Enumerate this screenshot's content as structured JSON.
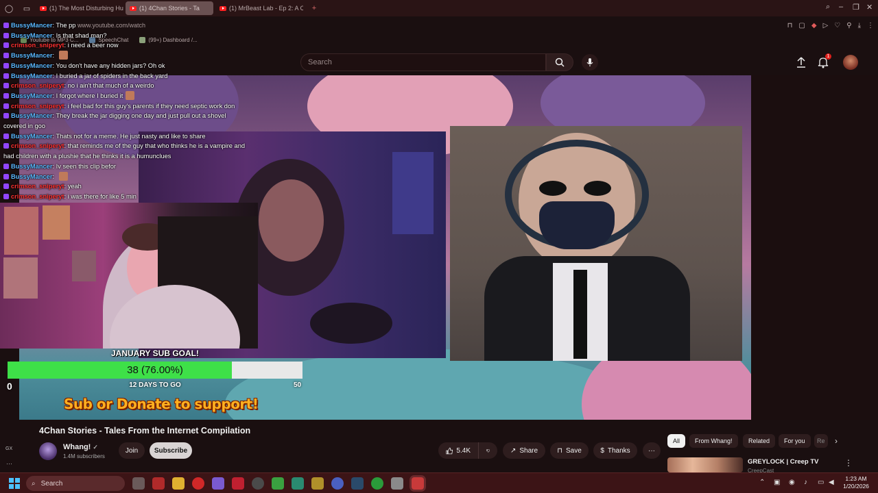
{
  "browser": {
    "tabs": [
      {
        "label": "(1) The Most Disturbing Hu",
        "active": false
      },
      {
        "label": "(1) 4Chan Stories - Ta",
        "active": true
      },
      {
        "label": "(1) MrBeast Lab - Ep 2: A C",
        "active": false
      }
    ],
    "new_tab": "+",
    "url": "www.youtube.com/watch",
    "bookmarks": [
      "Youtube to MP3 C...",
      "SpeechChat",
      "(99+) Dashboard /..."
    ]
  },
  "yt": {
    "search_placeholder": "Search",
    "notifications_count": "1"
  },
  "chat": [
    {
      "user": "BussyMancer",
      "cls": "u-bussy",
      "text": "The pp",
      "emote": false
    },
    {
      "user": "BussyMancer",
      "cls": "u-bussy",
      "text": "Is that shad man?",
      "emote": false
    },
    {
      "user": "crimson_sniperyt",
      "cls": "u-crimson",
      "text": "i need a beer now",
      "emote": false
    },
    {
      "user": "BussyMancer",
      "cls": "u-bussy",
      "text": "",
      "emote": true
    },
    {
      "user": "BussyMancer",
      "cls": "u-bussy",
      "text": "You don't have any hidden jars? Oh ok",
      "emote": false
    },
    {
      "user": "BussyMancer",
      "cls": "u-bussy",
      "text": "I buried a jar of spiders in the back yard",
      "emote": false
    },
    {
      "user": "crimson_sniperyt",
      "cls": "u-crimson",
      "text": "no i ain't that much of a weirdo",
      "emote": false
    },
    {
      "user": "BussyMancer",
      "cls": "u-bussy",
      "text": "I forgot where I buried it",
      "emote": true
    },
    {
      "user": "crimson_sniperyt",
      "cls": "u-crimson",
      "text": "i feel bad for this guy's parents if they need septic work don",
      "emote": false
    },
    {
      "user": "BussyMancer",
      "cls": "u-bussy",
      "text": "They break the jar digging one day and just pull out a shovel covered in goo",
      "emote": false
    },
    {
      "user": "BussyMancer",
      "cls": "u-bussy",
      "text": "Thats not for a meme. He just nasty and like to share",
      "emote": false
    },
    {
      "user": "crimson_sniperyt",
      "cls": "u-crimson",
      "text": "that reminds me of the guy that who thinks he is a vampire and had children with a plushie that he thinks it is a humunclues",
      "emote": false
    },
    {
      "user": "BussyMancer",
      "cls": "u-bussy",
      "text": "Iv seen this clip befor",
      "emote": false
    },
    {
      "user": "BussyMancer",
      "cls": "u-bussy",
      "text": "",
      "emote": true
    },
    {
      "user": "crimson_sniperyt",
      "cls": "u-crimson",
      "text": "yeah",
      "emote": false
    },
    {
      "user": "crimson_sniperyt",
      "cls": "u-crimson",
      "text": "i was there for like 5 min",
      "emote": false
    }
  ],
  "goal": {
    "title": "JANUARY SUB GOAL!",
    "progress_text": "38 (76.00%)",
    "progress_fraction": 0.76,
    "min": "0",
    "max": "50",
    "days_left": "12 DAYS TO GO",
    "banner": "Sub or Donate to support!"
  },
  "video": {
    "title": "4Chan Stories - Tales From the Internet Compilation",
    "channel": "Whang!",
    "subscribers": "1.4M subscribers",
    "join_label": "Join",
    "subscribe_label": "Subscribe",
    "likes": "5.4K",
    "share_label": "Share",
    "save_label": "Save",
    "thanks_label": "Thanks"
  },
  "chips": [
    "All",
    "From Whang!",
    "Related",
    "For you",
    "Re"
  ],
  "recommendation": {
    "title": "GREYLOCK | Creep TV",
    "channel": "CreepCast"
  },
  "rail": {
    "gx": "GX",
    "dots": "···"
  },
  "taskbar": {
    "search_label": "Search",
    "time": "1:23 AM",
    "date": "1/20/2026"
  },
  "colors": {
    "goal_fill": "#3ee048",
    "user_blue": "#5ab8ff",
    "user_red": "#ff3030",
    "banner_orange": "#ffb020"
  }
}
